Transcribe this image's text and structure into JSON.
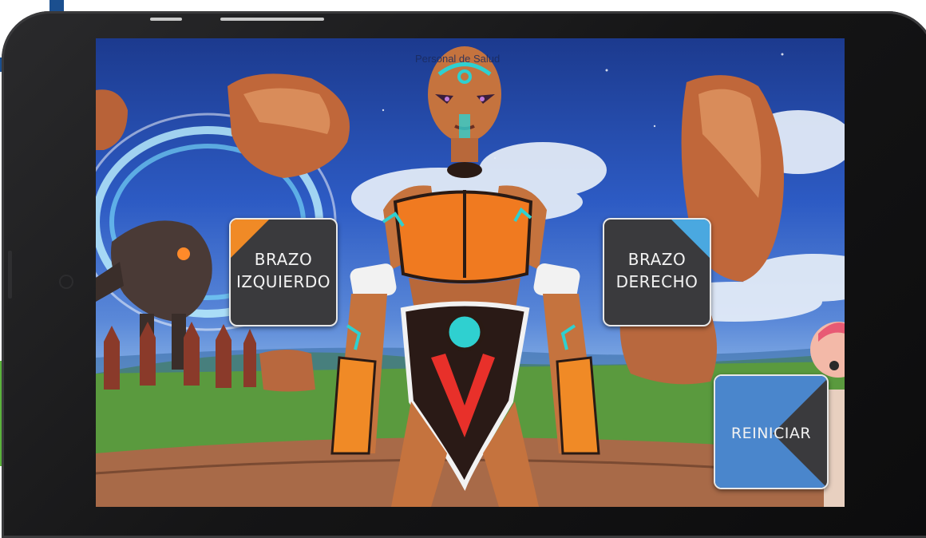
{
  "scene": {
    "title": "Personal de Salud"
  },
  "buttons": {
    "left_arm": {
      "line1": "BRAZO",
      "line2": "IZQUIERDO",
      "accent": "#f08a26"
    },
    "right_arm": {
      "line1": "BRAZO",
      "line2": "DERECHO",
      "accent": "#4aa8e0"
    },
    "reset": {
      "label": "REINICIAR",
      "accent": "#4a86cc"
    }
  },
  "colors": {
    "button_bg": "#3a3a3d",
    "sky_top": "#1c3a8e",
    "grass": "#4f8a38",
    "character_suit": "#f07a20",
    "character_accent": "#2fd0d0"
  }
}
